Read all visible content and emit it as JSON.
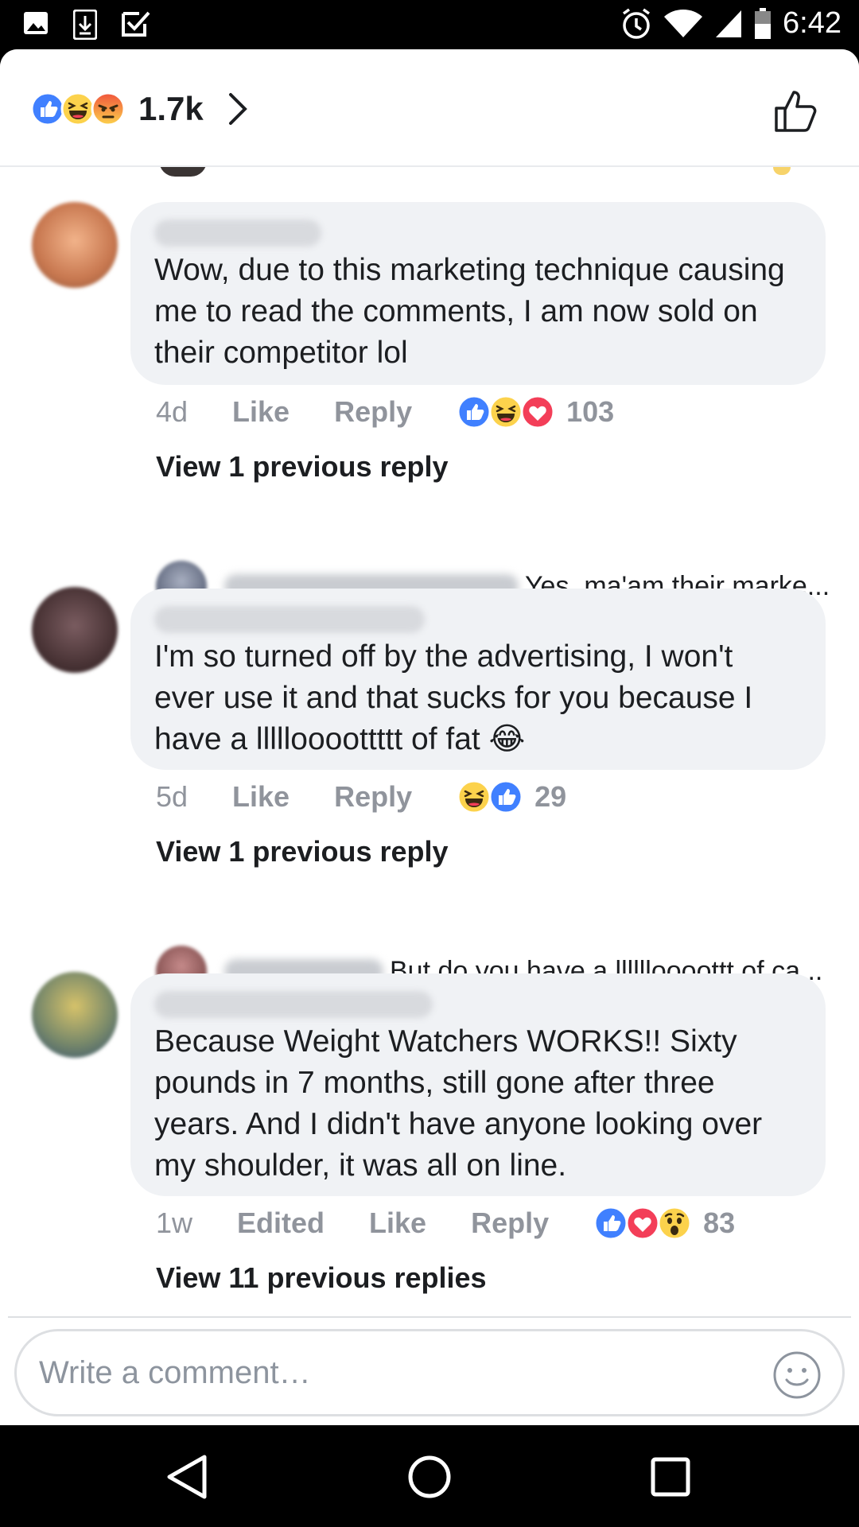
{
  "status_bar": {
    "time": "6:42",
    "left_icons": [
      "image-icon",
      "download-icon",
      "check-box-icon"
    ],
    "right_icons": [
      "alarm-icon",
      "wifi-icon",
      "signal-icon",
      "battery-icon"
    ]
  },
  "header": {
    "reaction_icons": [
      "like",
      "haha",
      "angry"
    ],
    "reaction_count": "1.7k",
    "chevron_icon": "chevron-right-icon",
    "like_icon": "thumbs-up-icon"
  },
  "comments": [
    {
      "text": "Wow, due to this marketing technique causing me to read the comments, I am now sold on their competitor lol",
      "time": "4d",
      "like_label": "Like",
      "reply_label": "Reply",
      "reactions": [
        "like",
        "haha",
        "love"
      ],
      "reaction_count": "103",
      "view_previous": "View 1 previous reply",
      "latest_reply": "Yes, ma'am their marke..."
    },
    {
      "text": "I'm so turned off by the advertising, I won't ever use it and that sucks for you because I have a llllloooottttt of fat",
      "emoji": "😂",
      "time": "5d",
      "like_label": "Like",
      "reply_label": "Reply",
      "reactions": [
        "haha",
        "like"
      ],
      "reaction_count": "29",
      "view_previous": "View 1 previous reply",
      "latest_reply": "But do you have a lllllloooottt of ca..."
    },
    {
      "text": "Because  Weight Watchers WORKS!! Sixty pounds in 7 months, still gone after three years. And I didn't have anyone looking over my shoulder, it was all on line.",
      "time": "1w",
      "edited_label": "Edited",
      "like_label": "Like",
      "reply_label": "Reply",
      "reactions": [
        "like",
        "love",
        "wow"
      ],
      "reaction_count": "83",
      "view_previous": "View 11 previous replies"
    }
  ],
  "composer": {
    "placeholder": "Write a comment…",
    "emoji_icon": "smiley-icon"
  },
  "nav_bar": {
    "icons": [
      "back-icon",
      "home-icon",
      "recents-icon"
    ]
  },
  "colors": {
    "like_blue": "#4080ff",
    "love_red": "#f33e58",
    "haha_yellow": "#fcd24c",
    "angry_orange": "#e9710f",
    "bubble_gray": "#f0f2f5",
    "meta_gray": "#90949c"
  }
}
